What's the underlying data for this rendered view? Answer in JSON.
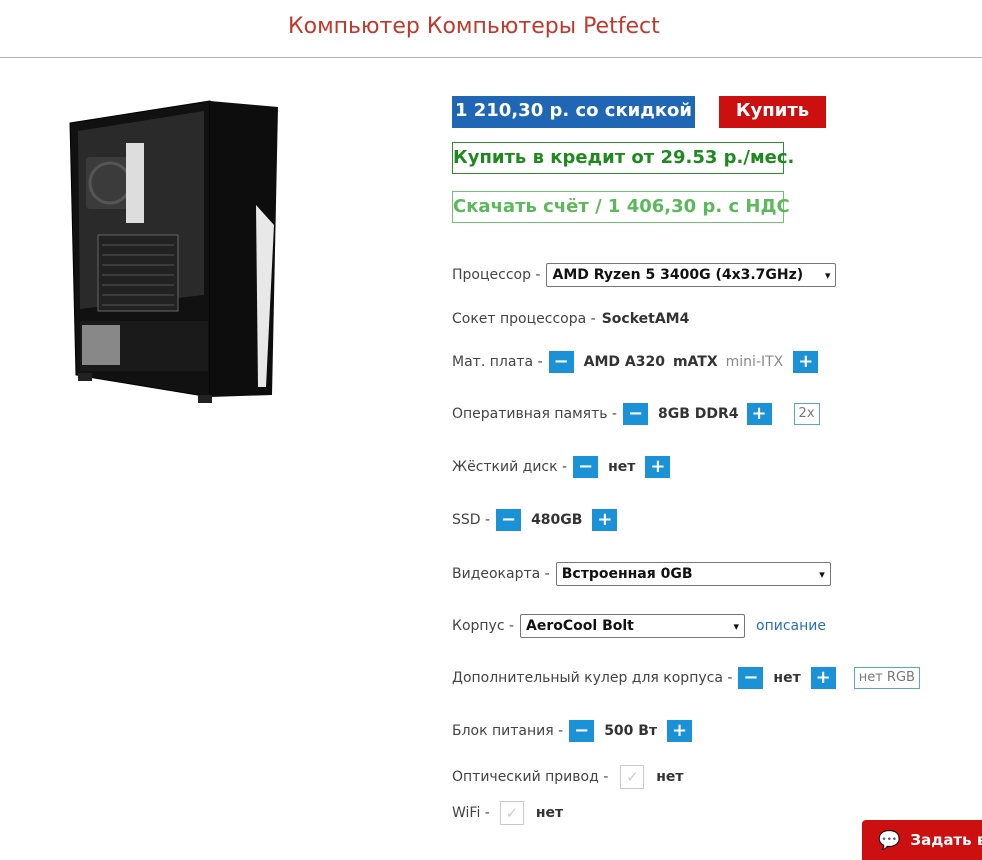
{
  "header": {
    "title": "Компьютер Компьютеры Petfect"
  },
  "pricing": {
    "price_discount": "1 210,30 р. со скидкой",
    "buy_label": "Купить",
    "credit_label": "Купить в кредит от 29.53 р./мес.",
    "invoice_label": "Скачать счёт / 1 406,30 р. с НДС"
  },
  "config": {
    "processor": {
      "label": "Процессор -",
      "selected": "AMD Ryzen 5 3400G (4x3.7GHz)"
    },
    "socket": {
      "label": "Сокет процессора -",
      "value": "SocketAM4"
    },
    "motherboard": {
      "label": "Мат. плата -",
      "value": "AMD A320",
      "form": "mATX",
      "alt_form": "mini-ITX"
    },
    "ram": {
      "label": "Оперативная память -",
      "value": "8GB DDR4",
      "badge": "2x"
    },
    "hdd": {
      "label": "Жёсткий диск -",
      "value": "нет"
    },
    "ssd": {
      "label": "SSD -",
      "value": "480GB"
    },
    "gpu": {
      "label": "Видеокарта -",
      "selected": "Встроенная 0GB"
    },
    "case": {
      "label": "Корпус -",
      "selected": "AeroCool Bolt",
      "link": "описание"
    },
    "cooler": {
      "label": "Дополнительный кулер для корпуса -",
      "value": "нет",
      "badge": "нет RGB"
    },
    "psu": {
      "label": "Блок питания -",
      "value": "500 Вт"
    },
    "optical": {
      "label": "Оптический привод -",
      "value": "нет"
    },
    "wifi": {
      "label": "WiFi -",
      "value": "нет"
    }
  },
  "chat": {
    "label": "Задать в"
  },
  "icons": {
    "minus": "−",
    "plus": "+",
    "check": "✓",
    "chevron": "▾",
    "chat": "💬"
  },
  "colors": {
    "title_red": "#c0392b",
    "price_blue": "#1f67b5",
    "buy_red": "#cc0f0f",
    "credit_green": "#1e8a1e",
    "invoice_green": "#5cb85c",
    "stepper_blue": "#1b92d6"
  }
}
